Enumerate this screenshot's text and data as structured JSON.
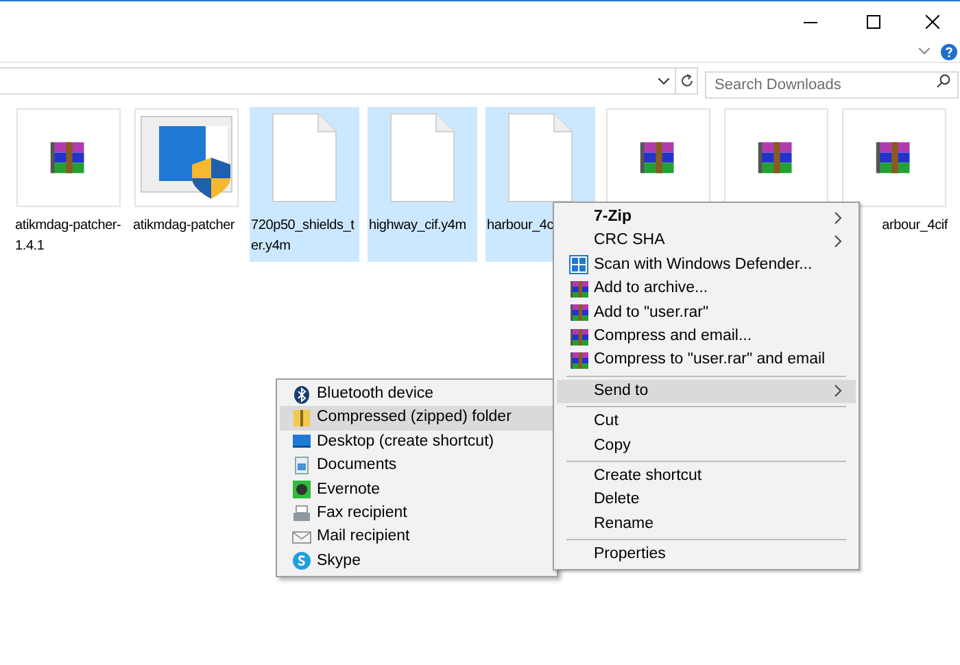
{
  "search": {
    "placeholder": "Search Downloads"
  },
  "files": [
    {
      "label": "atikmdag-patcher-1.4.1",
      "kind": "archive",
      "selected": false
    },
    {
      "label": "atikmdag-patcher",
      "kind": "installer",
      "selected": false
    },
    {
      "label": "720p50_shields_ter.y4m",
      "kind": "blank",
      "selected": true
    },
    {
      "label": "highway_cif.y4m",
      "kind": "blank",
      "selected": true
    },
    {
      "label": "harbour_4c",
      "kind": "blank",
      "selected": true
    },
    {
      "kind": "archive",
      "selected": false
    },
    {
      "kind": "archive",
      "selected": false
    },
    {
      "label": "arbour_4cif",
      "kind": "archive",
      "selected": false
    }
  ],
  "context_menu": [
    {
      "kind": "text",
      "label": "7-Zip",
      "bold": true,
      "submenu": true,
      "selected": false
    },
    {
      "kind": "text",
      "label": "CRC SHA",
      "bold": false,
      "submenu": true,
      "selected": false
    },
    {
      "kind": "defender",
      "label": "Scan with Windows Defender...",
      "bold": false,
      "submenu": false,
      "selected": false
    },
    {
      "kind": "archive",
      "label": "Add to archive...",
      "bold": false,
      "submenu": false,
      "selected": false
    },
    {
      "kind": "archive",
      "label": "Add to \"user.rar\"",
      "bold": false,
      "submenu": false,
      "selected": false
    },
    {
      "kind": "archive",
      "label": "Compress and email...",
      "bold": false,
      "submenu": false,
      "selected": false
    },
    {
      "kind": "archive",
      "label": "Compress to \"user.rar\" and email",
      "bold": false,
      "submenu": false,
      "selected": false
    },
    {
      "kind": "separator"
    },
    {
      "kind": "text",
      "label": "Send to",
      "bold": false,
      "submenu": true,
      "selected": true
    },
    {
      "kind": "separator"
    },
    {
      "kind": "text",
      "label": "Cut",
      "bold": false,
      "submenu": false,
      "selected": false
    },
    {
      "kind": "text",
      "label": "Copy",
      "bold": false,
      "submenu": false,
      "selected": false
    },
    {
      "kind": "separator"
    },
    {
      "kind": "text",
      "label": "Create shortcut",
      "bold": false,
      "submenu": false,
      "selected": false
    },
    {
      "kind": "text",
      "label": "Delete",
      "bold": false,
      "submenu": false,
      "selected": false
    },
    {
      "kind": "text",
      "label": "Rename",
      "bold": false,
      "submenu": false,
      "selected": false
    },
    {
      "kind": "separator"
    },
    {
      "kind": "text",
      "label": "Properties",
      "bold": false,
      "submenu": false,
      "selected": false
    }
  ],
  "send_to_menu": [
    {
      "label": "Bluetooth device",
      "kind": "bluetooth",
      "selected": false
    },
    {
      "label": "Compressed (zipped) folder",
      "kind": "zip",
      "selected": true
    },
    {
      "label": "Desktop (create shortcut)",
      "kind": "desktop",
      "selected": false
    },
    {
      "label": "Documents",
      "kind": "documents",
      "selected": false
    },
    {
      "label": "Evernote",
      "kind": "evernote",
      "selected": false
    },
    {
      "label": "Fax recipient",
      "kind": "fax",
      "selected": false
    },
    {
      "label": "Mail recipient",
      "kind": "mail",
      "selected": false
    },
    {
      "label": "Skype",
      "kind": "skype",
      "selected": false
    }
  ]
}
